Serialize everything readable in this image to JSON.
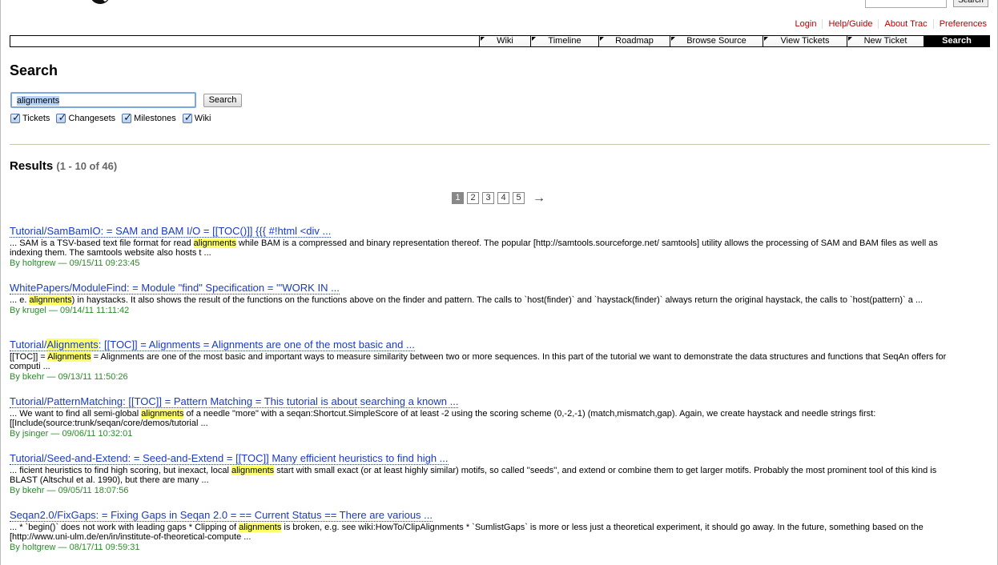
{
  "header": {
    "top_search_button": "Search",
    "metanav": [
      "Login",
      "Help/Guide",
      "About Trac",
      "Preferences"
    ]
  },
  "mainnav": {
    "tabs": [
      {
        "label": "Wiki",
        "w": 64
      },
      {
        "label": "Timeline",
        "w": 85
      },
      {
        "label": "Roadmap",
        "w": 89
      },
      {
        "label": "Browse Source",
        "w": 116
      },
      {
        "label": "View Tickets",
        "w": 105
      },
      {
        "label": "New Ticket",
        "w": 96
      },
      {
        "label": "Search",
        "w": 82,
        "active": true
      }
    ]
  },
  "page": {
    "title": "Search",
    "query": "alignments",
    "search_button": "Search",
    "filters": [
      "Tickets",
      "Changesets",
      "Milestones",
      "Wiki"
    ]
  },
  "results": {
    "heading": "Results",
    "count": "(1 - 10 of 46)",
    "pages": [
      "1",
      "2",
      "3",
      "4",
      "5"
    ],
    "current_page": "1",
    "next": "→",
    "items": [
      {
        "title": "Tutorial/SamBamIO: = SAM and BAM I/O = [[TOC()]] {{{ #!html <div ...",
        "excerpt_before": "... SAM is a TSV-based text file format for read ",
        "highlight": "alignments",
        "excerpt_after": " while BAM is a compressed and binary representation thereof. The popular [http://samtools.sourceforge.net/ samtools] utility allows the processing of SAM and BAM files as well as indexing them. The samtools website also hosts t ...",
        "author": "holtgrew",
        "date": "09/15/11 09:23:45"
      },
      {
        "title": "WhitePapers/ModuleFind: = Module \"find\" Specification = '''WORK IN ...",
        "excerpt_before": "... e. ",
        "highlight": "alignments",
        "excerpt_after": ") in haystacks. It also shows the result of the functions on the functions above on the finder and pattern. The calls to `host(finder)` and `haystack(finder)` always return the original haystack, the calls to `host(pattern)` a ...",
        "author": "krugel",
        "date": "09/14/11 11:11:42"
      },
      {
        "title_before": "Tutorial/",
        "title_highlight": "Alignments",
        "title_after": ": [[TOC]] = Alignments = Alignments are one of the most basic and ...",
        "excerpt_before": "[[TOC]] = ",
        "highlight": "Alignments",
        "excerpt_after": " = Alignments are one of the most basic and important ways to measure similarity between two or more sequences. In this part of the tutorial we want to demonstrate the data structures and functions that SeqAn offers for computi ...",
        "author": "bkehr",
        "date": "09/13/11 11:50:26"
      },
      {
        "title": "Tutorial/PatternMatching: [[TOC]] = Pattern Matching = This tutorial is about searching a known ...",
        "excerpt_before": "... We want to find all semi-global ",
        "highlight": "alignments",
        "excerpt_after": " of a needle \"more\" with a seqan:Shortcut.SimpleScore of at least -2 using the scoring scheme (0,-2,-1) (match,mismatch,gap). Again, we create haystack and needle strings first: [[Include(source:trunk/seqan/core/demos/tutorial ...",
        "author": "jsinger",
        "date": "09/06/11 10:32:01"
      },
      {
        "title": "Tutorial/Seed-and-Extend: = Seed-and-Extend = [[TOC]] Many efficient heuristics to find high ...",
        "excerpt_before": "... ficient heuristics to find high scoring, but inexact, local ",
        "highlight": "alignments",
        "excerpt_after": " start with small exact (or at least highly similar) motifs, so called ''seeds'', and extend or combine them to get larger motifs. Probably the most prominent tool of this kind is BLAST (Altschul et al. 1990), but there are many ...",
        "author": "bkehr",
        "date": "09/05/11 18:07:56"
      },
      {
        "title": "Seqan2.0/FixGaps: = Fixing Gaps in Seqan 2.0 = == Current Status == There are various ...",
        "excerpt_before": "... * `begin()` does not work with leading gaps * Clipping of ",
        "highlight": "alignments",
        "excerpt_after": " is broken, e.g. see wiki:HowTo/ClipAlignments * `SumlistGaps` is more or less just a theoretical experiment, it should go away. In the future, something based on the [http://www.uni-ulm.de/en/in/institute-of-theoretical-compute ...",
        "author": "holtgrew",
        "date": "08/17/11 09:59:31"
      }
    ]
  }
}
